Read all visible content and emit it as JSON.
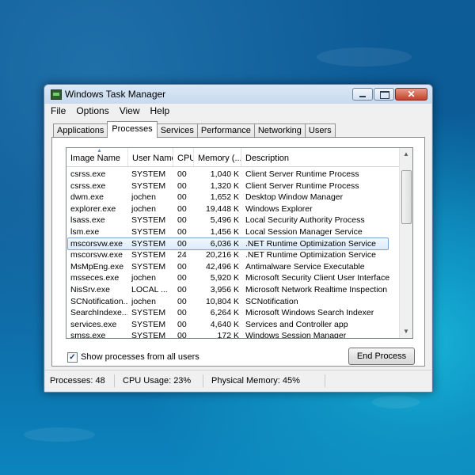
{
  "window": {
    "title": "Windows Task Manager",
    "icon": "task-manager-icon",
    "controls": {
      "close_glyph": "✕"
    }
  },
  "menu": [
    "File",
    "Options",
    "View",
    "Help"
  ],
  "tabs": [
    "Applications",
    "Processes",
    "Services",
    "Performance",
    "Networking",
    "Users"
  ],
  "active_tab": "Processes",
  "columns": [
    "Image Name",
    "User Name",
    "CPU",
    "Memory (...",
    "Description"
  ],
  "processes": [
    {
      "name": "csrss.exe",
      "user": "SYSTEM",
      "cpu": "00",
      "mem": "1,040 K",
      "desc": "Client Server Runtime Process"
    },
    {
      "name": "csrss.exe",
      "user": "SYSTEM",
      "cpu": "00",
      "mem": "1,320 K",
      "desc": "Client Server Runtime Process"
    },
    {
      "name": "dwm.exe",
      "user": "jochen",
      "cpu": "00",
      "mem": "1,652 K",
      "desc": "Desktop Window Manager"
    },
    {
      "name": "explorer.exe",
      "user": "jochen",
      "cpu": "00",
      "mem": "19,448 K",
      "desc": "Windows Explorer"
    },
    {
      "name": "lsass.exe",
      "user": "SYSTEM",
      "cpu": "00",
      "mem": "5,496 K",
      "desc": "Local Security Authority Process"
    },
    {
      "name": "lsm.exe",
      "user": "SYSTEM",
      "cpu": "00",
      "mem": "1,456 K",
      "desc": "Local Session Manager Service"
    },
    {
      "name": "mscorsvw.exe",
      "user": "SYSTEM",
      "cpu": "00",
      "mem": "6,036 K",
      "desc": ".NET Runtime Optimization Service",
      "selected": true
    },
    {
      "name": "mscorsvw.exe",
      "user": "SYSTEM",
      "cpu": "24",
      "mem": "20,216 K",
      "desc": ".NET Runtime Optimization Service"
    },
    {
      "name": "MsMpEng.exe",
      "user": "SYSTEM",
      "cpu": "00",
      "mem": "42,496 K",
      "desc": "Antimalware Service Executable"
    },
    {
      "name": "msseces.exe",
      "user": "jochen",
      "cpu": "00",
      "mem": "5,920 K",
      "desc": "Microsoft Security Client User Interface"
    },
    {
      "name": "NisSrv.exe",
      "user": "LOCAL ...",
      "cpu": "00",
      "mem": "3,956 K",
      "desc": "Microsoft Network Realtime Inspection ..."
    },
    {
      "name": "SCNotification...",
      "user": "jochen",
      "cpu": "00",
      "mem": "10,804 K",
      "desc": "SCNotification"
    },
    {
      "name": "SearchIndexe...",
      "user": "SYSTEM",
      "cpu": "00",
      "mem": "6,264 K",
      "desc": "Microsoft Windows Search Indexer"
    },
    {
      "name": "services.exe",
      "user": "SYSTEM",
      "cpu": "00",
      "mem": "4,640 K",
      "desc": "Services and Controller app"
    },
    {
      "name": "smss.exe",
      "user": "SYSTEM",
      "cpu": "00",
      "mem": "172 K",
      "desc": "Windows Session Manager"
    }
  ],
  "show_all_label": "Show processes from all users",
  "show_all_checked": true,
  "end_process_label": "End Process",
  "status": {
    "processes": "Processes: 48",
    "cpu": "CPU Usage: 23%",
    "memory": "Physical Memory: 45%"
  }
}
